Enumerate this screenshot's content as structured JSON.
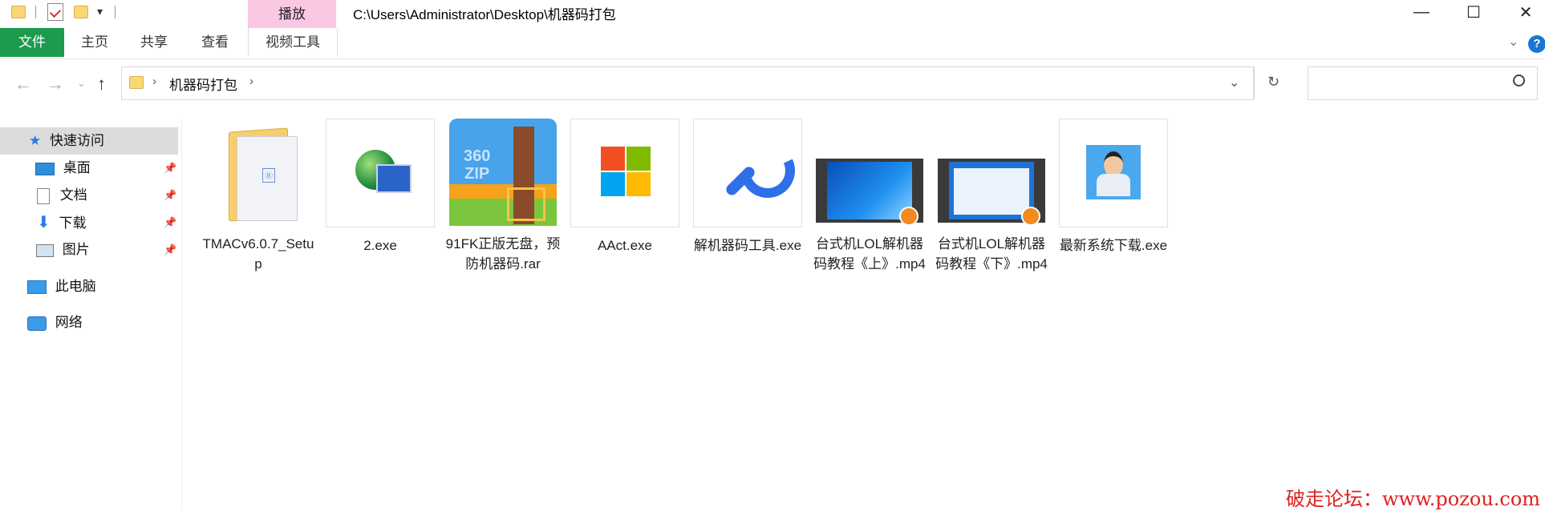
{
  "window": {
    "title_path": "C:\\Users\\Administrator\\Desktop\\机器码打包",
    "context_tab_header": "播放",
    "controls": {
      "minimize": "—",
      "maximize": "☐",
      "close": "✕"
    }
  },
  "ribbon": {
    "tabs": [
      {
        "label": "文件",
        "active": true
      },
      {
        "label": "主页"
      },
      {
        "label": "共享"
      },
      {
        "label": "查看"
      },
      {
        "label": "视频工具"
      }
    ],
    "help": "?"
  },
  "navbar": {
    "back_icon": "arrow-left-icon",
    "forward_icon": "arrow-right-icon",
    "recent_icon": "chevron-down-icon",
    "up_icon": "arrow-up-icon",
    "breadcrumb": [
      "机器码打包"
    ],
    "search_placeholder": ""
  },
  "sidebar": {
    "items": [
      {
        "label": "快速访问",
        "icon": "star-icon",
        "selected": true
      },
      {
        "label": "桌面",
        "icon": "desktop-icon",
        "pinned": true
      },
      {
        "label": "文档",
        "icon": "document-icon",
        "pinned": true
      },
      {
        "label": "下载",
        "icon": "download-icon",
        "pinned": true
      },
      {
        "label": "图片",
        "icon": "pictures-icon",
        "pinned": true
      },
      {
        "label": "此电脑",
        "icon": "computer-icon"
      },
      {
        "label": "网络",
        "icon": "network-icon"
      }
    ]
  },
  "files": [
    {
      "name": "TMACv6.0.7_Setup",
      "type": "folder"
    },
    {
      "name": "2.exe",
      "type": "exe-globe"
    },
    {
      "name": "91FK正版无盘，预防机器码.rar",
      "type": "archive-360zip"
    },
    {
      "name": "AAct.exe",
      "type": "exe-windows"
    },
    {
      "name": "解机器码工具.exe",
      "type": "exe-wrench"
    },
    {
      "name": "台式机LOL解机器码教程《上》.mp4",
      "type": "video"
    },
    {
      "name": "台式机LOL解机器码教程《下》.mp4",
      "type": "video"
    },
    {
      "name": "最新系统下载.exe",
      "type": "exe-person"
    }
  ],
  "watermark": "破走论坛：www.pozou.com",
  "colors": {
    "file_tab": "#1c9b4e",
    "context_tab": "#fbc8e4",
    "help": "#1976d2"
  }
}
